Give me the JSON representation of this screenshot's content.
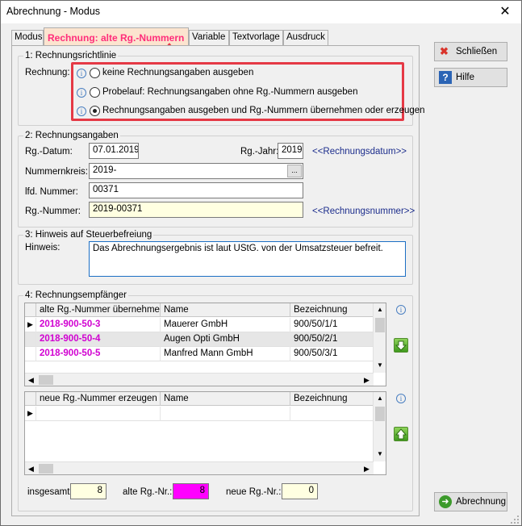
{
  "window": {
    "title": "Abrechnung - Modus",
    "close": "✕"
  },
  "tabs": [
    {
      "label": "Modus"
    },
    {
      "label": "Rechnung: alte Rg.-Nummern"
    },
    {
      "label": "Variable"
    },
    {
      "label": "Textvorlage"
    },
    {
      "label": "Ausdruck"
    }
  ],
  "section1": {
    "legend": "1: Rechnungsrichtlinie",
    "label": "Rechnung:",
    "options": [
      {
        "label": "keine Rechnungsangaben ausgeben",
        "checked": false
      },
      {
        "label": "Probelauf: Rechnungsangaben ohne Rg.-Nummern ausgeben",
        "checked": false
      },
      {
        "label": "Rechnungsangaben ausgeben und Rg.-Nummern übernehmen oder erzeugen",
        "checked": true
      }
    ]
  },
  "section2": {
    "legend": "2: Rechnungsangaben",
    "rg_datum_label": "Rg.-Datum:",
    "rg_datum": "07.01.2019",
    "rg_jahr_label": "Rg.-Jahr:",
    "rg_jahr": "2019",
    "rg_datum_link": "<<Rechnungsdatum>>",
    "nummernkreis_label": "Nummernkreis:",
    "nummernkreis": "2019-",
    "browse": "...",
    "lfd_label": "lfd. Nummer:",
    "lfd": "00371",
    "rg_nummer_label": "Rg.-Nummer:",
    "rg_nummer": "2019-00371",
    "rg_nummer_link": "<<Rechnungsnummer>>"
  },
  "section3": {
    "legend": "3: Hinweis auf Steuerbefreiung",
    "label": "Hinweis:",
    "text": "Das Abrechnungsergebnis ist laut UStG. von der Umsatzsteuer befreit."
  },
  "section4": {
    "legend": "4: Rechnungsempfänger",
    "grid1": {
      "columns": [
        "alte Rg.-Nummer übernehmen",
        "Name",
        "Bezeichnung"
      ],
      "rows": [
        {
          "nr": "2018-900-50-3",
          "name": "Mauerer GmbH",
          "bez": "900/50/1/1"
        },
        {
          "nr": "2018-900-50-4",
          "name": "Augen Opti GmbH",
          "bez": "900/50/2/1"
        },
        {
          "nr": "2018-900-50-5",
          "name": "Manfred Mann GmbH",
          "bez": "900/50/3/1"
        }
      ]
    },
    "grid2": {
      "columns": [
        "neue Rg.-Nummer erzeugen",
        "Name",
        "Bezeichnung"
      ]
    },
    "insgesamt_label": "insgesamt:",
    "insgesamt": "8",
    "alte_label": "alte Rg.-Nr.:",
    "alte": "8",
    "neue_label": "neue Rg.-Nr.:",
    "neue": "0"
  },
  "buttons": {
    "schliessen": "Schließen",
    "hilfe": "Hilfe",
    "abrechnung": "Abrechnung"
  },
  "colors": {
    "active_tab_text": "#ff2d7a",
    "highlight": "#e53945",
    "magenta": "#d100d1"
  }
}
